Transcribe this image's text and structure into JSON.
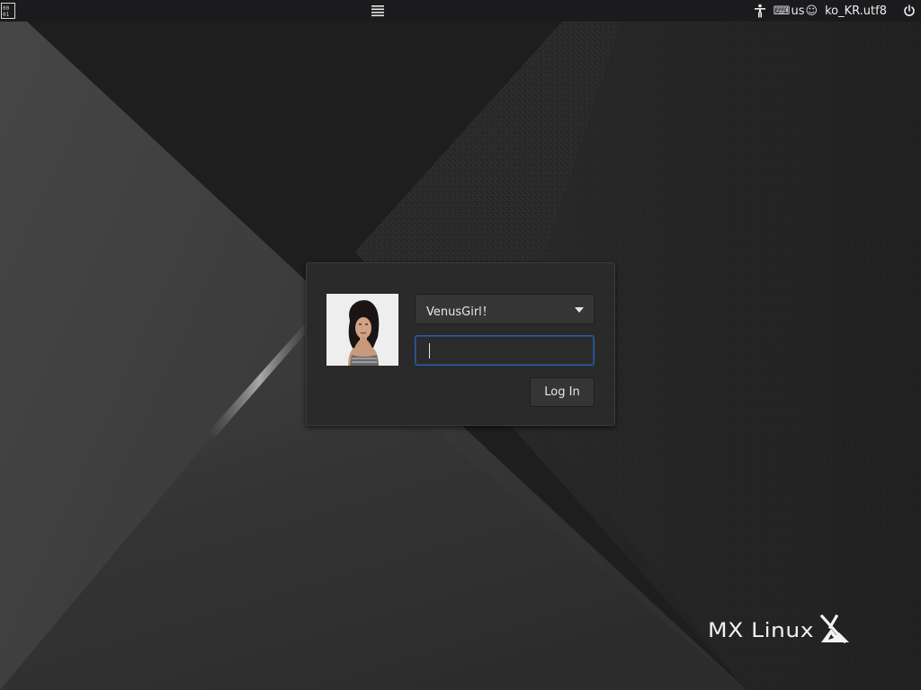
{
  "topbar": {
    "left_icon": "binary-clock-icon",
    "menu_icon": "hamburger-menu-icon",
    "accessibility_icon": "accessibility-icon",
    "keyboard_icon": "keyboard-icon",
    "keyboard_layout": "us",
    "language_icon": "smiley-icon",
    "language": "ko_KR.utf8",
    "power_icon": "power-icon"
  },
  "login": {
    "username": "VenusGirl！",
    "dropdown_icon": "chevron-down-icon",
    "password_value": "",
    "login_button": "Log In",
    "focus_color": "#2c5d9c"
  },
  "branding": {
    "logo_text": "MX Linux",
    "logo_icon": "mx-logo-icon"
  }
}
